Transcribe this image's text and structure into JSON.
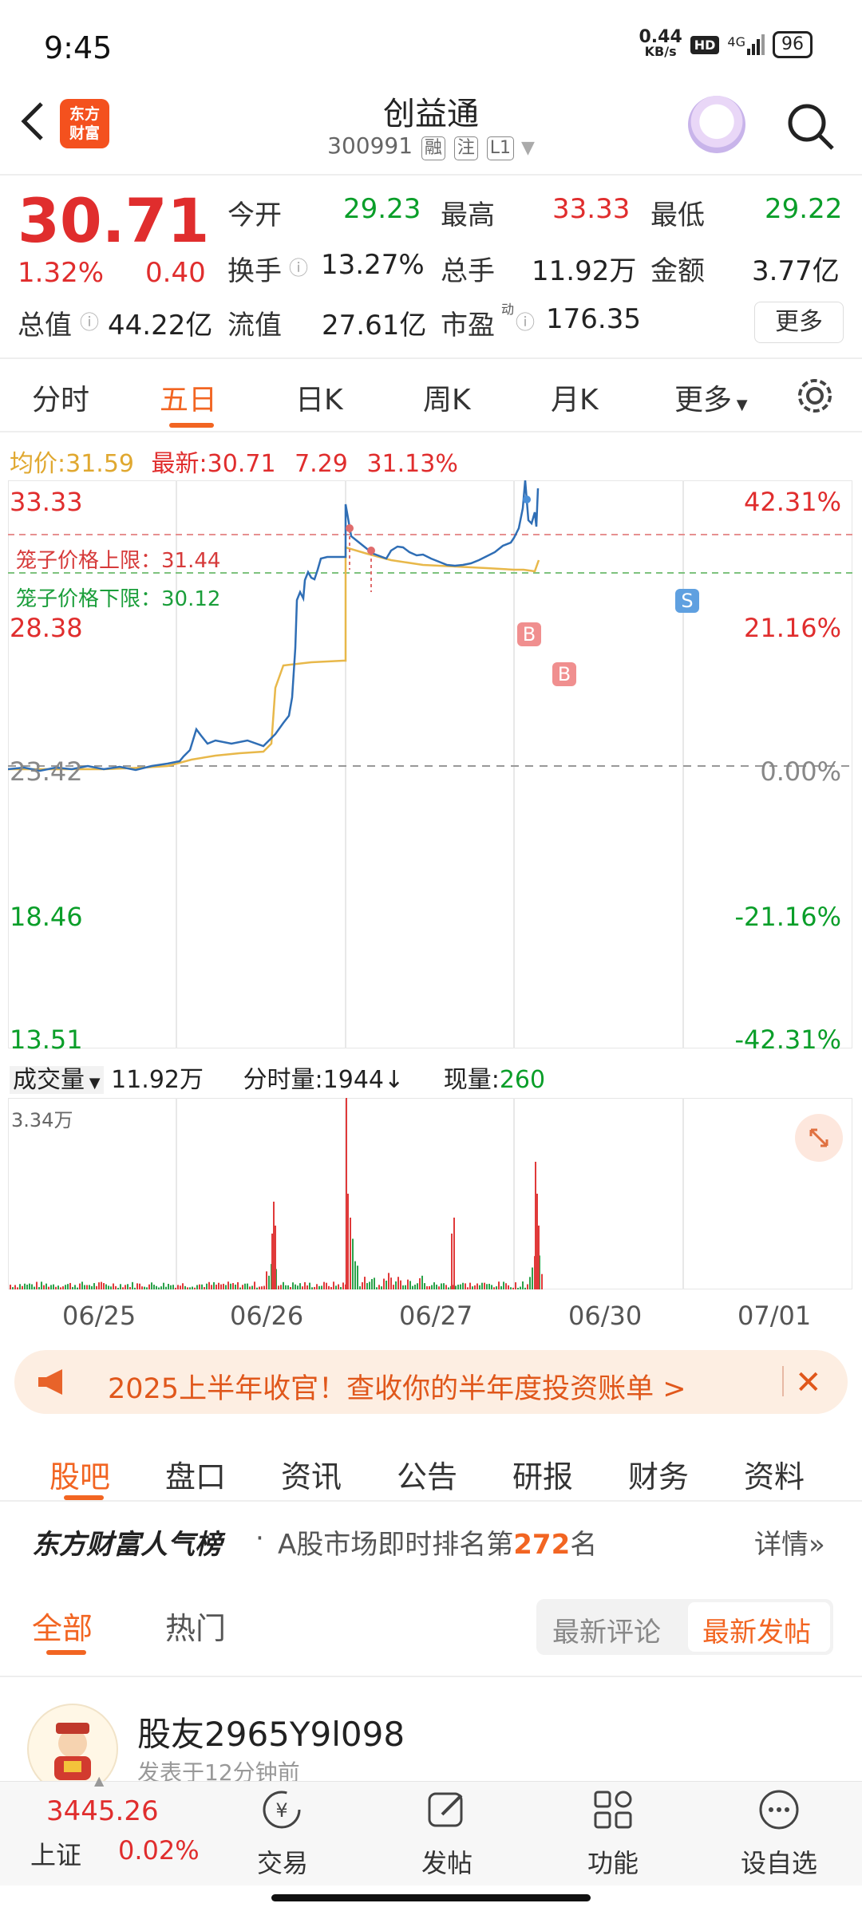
{
  "status": {
    "time": "9:45",
    "net_speed": "0.44",
    "net_unit": "KB/s",
    "hd": "HD",
    "network": "4G",
    "battery": "96"
  },
  "header": {
    "title": "创益通",
    "code": "300991",
    "tags": [
      "融",
      "注",
      "L1"
    ],
    "logo_line1": "东方",
    "logo_line2": "财富"
  },
  "quote": {
    "price": "30.71",
    "change_pct": "1.32%",
    "change": "0.40",
    "open_label": "今开",
    "open": "29.23",
    "high_label": "最高",
    "high": "33.33",
    "low_label": "最低",
    "low": "29.22",
    "turnover_label": "换手",
    "turnover": "13.27%",
    "volume_label": "总手",
    "volume": "11.92万",
    "amount_label": "金额",
    "amount": "3.77亿",
    "mcap_label": "总值",
    "mcap": "44.22亿",
    "float_label": "流值",
    "float": "27.61亿",
    "pe_label": "市盈",
    "pe_sup": "动",
    "pe": "176.35",
    "more": "更多"
  },
  "ktabs": [
    "分时",
    "五日",
    "日K",
    "周K",
    "月K",
    "更多"
  ],
  "legend": {
    "avg_label": "均价:",
    "avg": "31.59",
    "latest_label": "最新:",
    "latest": "30.71",
    "chg": "7.29",
    "pct": "31.13%"
  },
  "chart": {
    "y_left": [
      "33.33",
      "28.38",
      "23.42",
      "18.46",
      "13.51"
    ],
    "y_right": [
      "42.31%",
      "21.16%",
      "0.00%",
      "-21.16%",
      "-42.31%"
    ],
    "cage_upper": "笼子价格上限：31.44",
    "cage_lower": "笼子价格下限：30.12",
    "marker_b": "B",
    "marker_s": "S"
  },
  "chart_data": {
    "type": "line",
    "x": [
      "06/25",
      "06/26",
      "06/27",
      "06/30",
      "07/01"
    ],
    "series": [
      {
        "values": [
          23.5,
          24.6,
          28.8,
          31.0,
          30.71
        ]
      }
    ],
    "ylim": [
      13.51,
      33.33
    ]
  },
  "volume": {
    "label": "成交量",
    "total": "11.92万",
    "tick_label": "分时量:",
    "tick": "1944",
    "tick_arrow": "↓",
    "now_label": "现量:",
    "now": "260",
    "max": "3.34万"
  },
  "dates": [
    "06/25",
    "06/26",
    "06/27",
    "06/30",
    "07/01"
  ],
  "banner": {
    "text": "2025上半年收官！查收你的半年度投资账单 >"
  },
  "btabs": [
    "股吧",
    "盘口",
    "资讯",
    "公告",
    "研报",
    "财务",
    "资料"
  ],
  "rank": {
    "brand": "东方财富人气榜",
    "dot": "·",
    "text": "A股市场即时排名第",
    "num": "272",
    "suffix": "名",
    "detail": "详情"
  },
  "filter": {
    "all": "全部",
    "hot": "热门",
    "latest_comment": "最新评论",
    "latest_post": "最新发帖"
  },
  "post": {
    "user": "股友2965Y9l098",
    "meta": "发表于12分钟前"
  },
  "bottom": {
    "index_value": "3445.26",
    "index_name": "上证",
    "index_pct": "0.02%",
    "trade": "交易",
    "post": "发帖",
    "func": "功能",
    "watch": "设自选"
  }
}
